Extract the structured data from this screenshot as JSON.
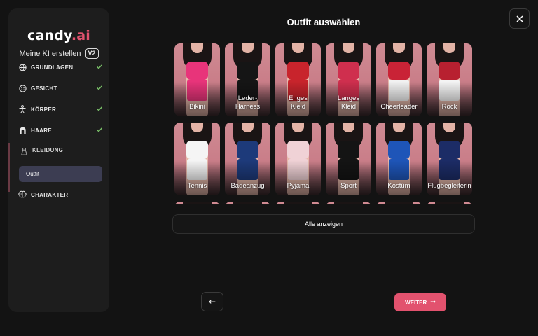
{
  "brand": {
    "name": "candy",
    "suffix": ".ai"
  },
  "sidebar": {
    "subtitle": "Meine KI erstellen",
    "version": "V2",
    "steps": [
      {
        "label": "GRUNDLAGEN",
        "icon": "globe-icon",
        "done": true
      },
      {
        "label": "GESICHT",
        "icon": "smiley-icon",
        "done": true
      },
      {
        "label": "KÖRPER",
        "icon": "body-icon",
        "done": true
      },
      {
        "label": "HAARE",
        "icon": "hair-icon",
        "done": true
      },
      {
        "label": "KLEIDUNG",
        "icon": "dress-icon",
        "done": false
      },
      {
        "label": "CHARAKTER",
        "icon": "brain-icon",
        "done": false
      }
    ],
    "active_sub_item": "Outfit"
  },
  "main": {
    "title": "Outfit auswählen",
    "outfits": [
      {
        "label": "Bikini",
        "top_color": "#e8347a",
        "bottom_color": "#e8347a"
      },
      {
        "label": "Leder-\nHarness",
        "top_color": "#151515",
        "bottom_color": "#151515"
      },
      {
        "label": "Enges\nKleid",
        "top_color": "#c8242c",
        "bottom_color": "#c8242c"
      },
      {
        "label": "Langes\nKleid",
        "top_color": "#cf2f4e",
        "bottom_color": "#cf2f4e"
      },
      {
        "label": "Cheerleader",
        "top_color": "#c92336",
        "bottom_color": "#f2f2f2"
      },
      {
        "label": "Rock",
        "top_color": "#b82030",
        "bottom_color": "#f4f4f4"
      },
      {
        "label": "Tennis",
        "top_color": "#f5f5f5",
        "bottom_color": "#f5f5f5"
      },
      {
        "label": "Badeanzug",
        "top_color": "#1d3a7a",
        "bottom_color": "#1d3a7a"
      },
      {
        "label": "Pyjama",
        "top_color": "#f0d2d6",
        "bottom_color": "#f0d2d6"
      },
      {
        "label": "Sport",
        "top_color": "#141414",
        "bottom_color": "#141414"
      },
      {
        "label": "Kostüm",
        "top_color": "#1e55b8",
        "bottom_color": "#1e55b8"
      },
      {
        "label": "Flugbegleiterin",
        "top_color": "#1c2c66",
        "bottom_color": "#1c2c66"
      }
    ],
    "show_all_label": "Alle anzeigen",
    "next_label": "WEITER",
    "next_arrow": "→",
    "back_arrow": "←"
  },
  "colors": {
    "accent": "#e2526e",
    "check": "#7cc46a",
    "active_sub": "#3c3d52"
  }
}
